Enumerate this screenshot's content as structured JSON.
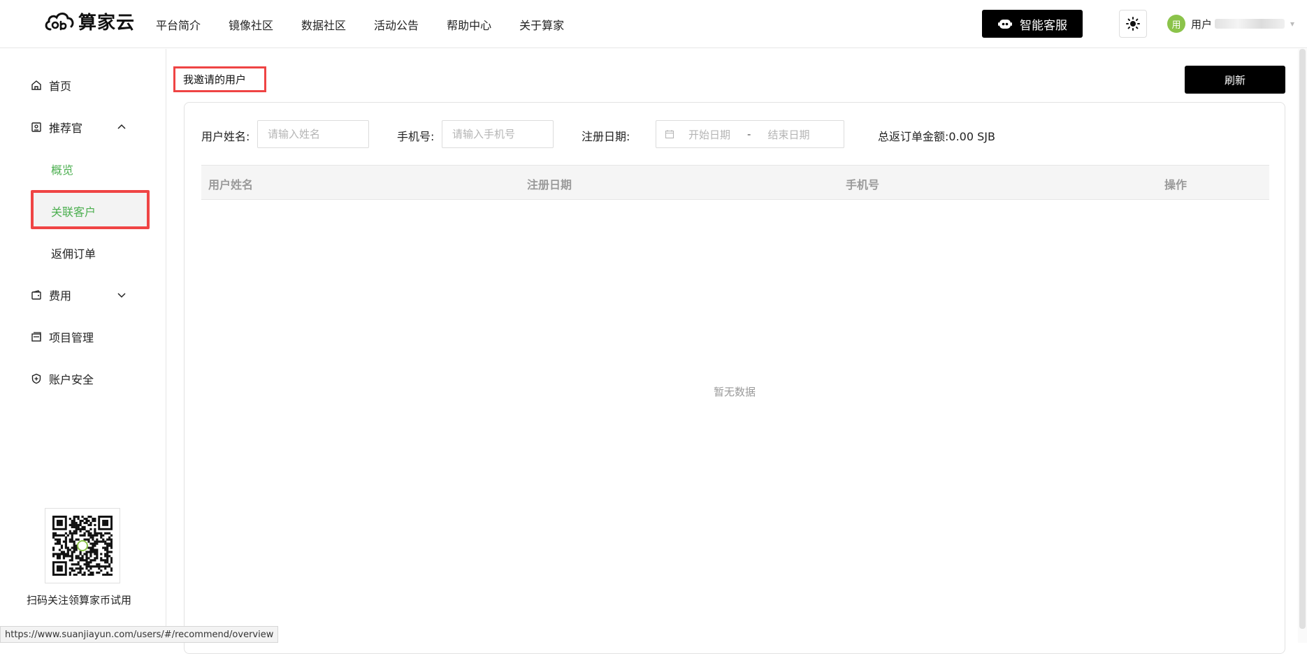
{
  "brand": {
    "name": "算家云"
  },
  "top_nav": [
    {
      "label": "平台简介"
    },
    {
      "label": "镜像社区"
    },
    {
      "label": "数据社区"
    },
    {
      "label": "活动公告"
    },
    {
      "label": "帮助中心"
    },
    {
      "label": "关于算家"
    }
  ],
  "header": {
    "service_label": "智能客服",
    "avatar_text": "用",
    "user_label": "用户"
  },
  "sidebar": {
    "home": "首页",
    "recommender": "推荐官",
    "sub_overview": "概览",
    "sub_customers": "关联客户",
    "sub_commission": "返佣订单",
    "fees": "费用",
    "projects": "项目管理",
    "security": "账户安全",
    "qr_caption": "扫码关注领算家币试用"
  },
  "main": {
    "page_title": "我邀请的用户",
    "refresh_label": "刷新",
    "filters": {
      "name_label": "用户姓名:",
      "name_placeholder": "请输入姓名",
      "phone_label": "手机号:",
      "phone_placeholder": "请输入手机号",
      "date_label": "注册日期:",
      "date_start": "开始日期",
      "date_sep": "-",
      "date_end": "结束日期",
      "total_label": "总返订单金额:",
      "total_value": "0.00 SJB"
    },
    "table": {
      "columns": [
        "用户姓名",
        "注册日期",
        "手机号",
        "操作"
      ],
      "empty_text": "暂无数据"
    }
  },
  "status_bar": {
    "url": "https://www.suanjiayun.com/users/#/recommend/overview"
  },
  "colors": {
    "accent_green": "#4caf50",
    "highlight_red": "#ef4444",
    "button_black": "#000000"
  }
}
